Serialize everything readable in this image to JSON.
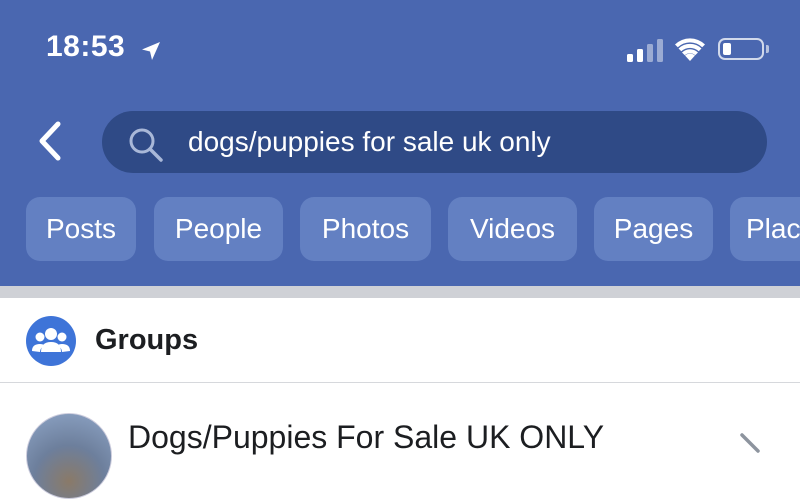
{
  "status_bar": {
    "time": "18:53",
    "location_icon": "location-arrow-icon",
    "signal_icon": "cellular-signal-icon",
    "wifi_icon": "wifi-icon",
    "battery_icon": "battery-icon"
  },
  "search": {
    "back_icon": "chevron-left-icon",
    "icon": "search-icon",
    "query": "dogs/puppies for sale uk only"
  },
  "filter_chips": [
    {
      "label": "Posts"
    },
    {
      "label": "People"
    },
    {
      "label": "Photos"
    },
    {
      "label": "Videos"
    },
    {
      "label": "Pages"
    },
    {
      "label": "Plac"
    }
  ],
  "section": {
    "icon": "groups-icon",
    "title": "Groups"
  },
  "results": [
    {
      "title": "Dogs/Puppies For Sale UK ONLY",
      "chevron_icon": "chevron-right-icon"
    }
  ],
  "colors": {
    "header_bg": "#4a67b0",
    "search_bg": "#2f4a86",
    "chip_bg": "#6380c2",
    "groups_icon_bg": "#3e74d8"
  }
}
